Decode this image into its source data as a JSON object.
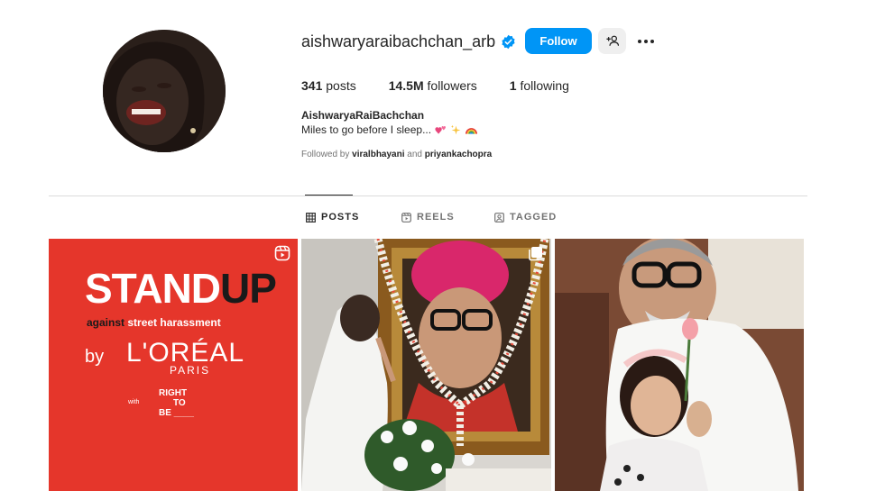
{
  "profile": {
    "username": "aishwaryaraibachchan_arb",
    "follow_label": "Follow",
    "full_name": "AishwaryaRaiBachchan",
    "bio": "Miles to go before I sleep...",
    "followed_by_prefix": "Followed by",
    "followed_by_user1": "viralbhayani",
    "followed_by_and": "and",
    "followed_by_user2": "priyankachopra"
  },
  "stats": {
    "posts_count": "341",
    "posts_label": "posts",
    "followers_count": "14.5M",
    "followers_label": "followers",
    "following_count": "1",
    "following_label": "following"
  },
  "tabs": [
    {
      "label": "POSTS",
      "icon": "grid-icon",
      "active": true
    },
    {
      "label": "REELS",
      "icon": "reels-icon",
      "active": false
    },
    {
      "label": "TAGGED",
      "icon": "tagged-icon",
      "active": false
    }
  ],
  "posts": [
    {
      "badge": "reel-icon",
      "lines": {
        "stand": "STAND",
        "up": "UP",
        "against": "against",
        "street": "street harassment",
        "by": "by",
        "brand": "L'ORÉAL",
        "paris": "PARIS",
        "with": "with",
        "right1": "RIGHT",
        "right2": "TO",
        "right3": "BE ____"
      }
    },
    {
      "badge": "carousel-icon"
    },
    {
      "badge": ""
    }
  ],
  "colors": {
    "accent": "#0095f6",
    "loreal_red": "#e5362b"
  }
}
